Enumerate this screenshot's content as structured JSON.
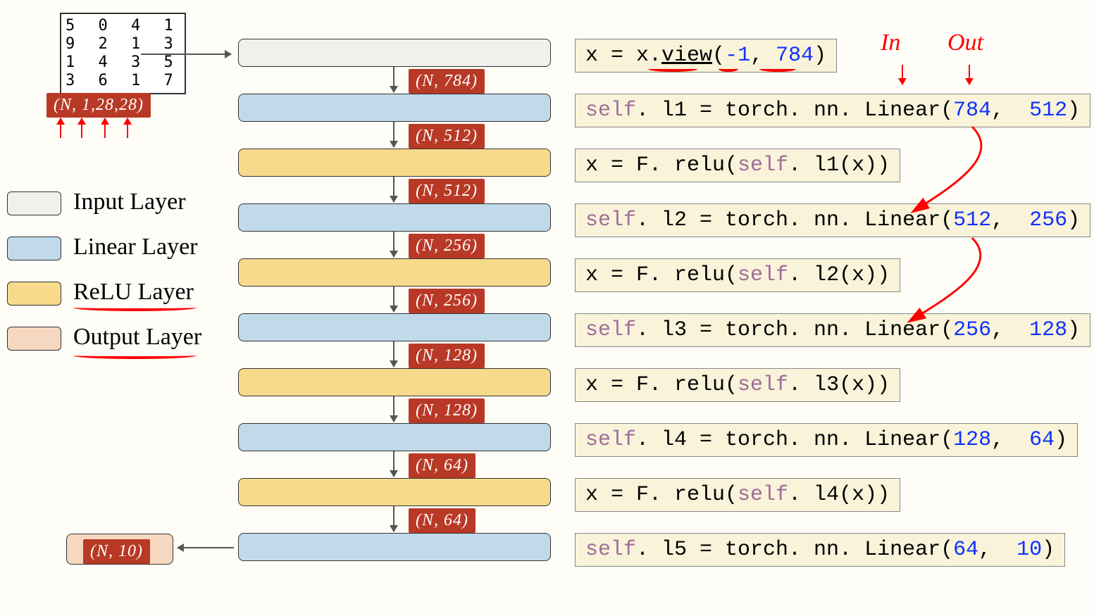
{
  "shapes": {
    "input_badge": "(N, 1,28,28)",
    "s1": "(N, 784)",
    "s2": "(N, 512)",
    "s3": "(N, 512)",
    "s4": "(N, 256)",
    "s5": "(N, 256)",
    "s6": "(N, 128)",
    "s7": "(N, 128)",
    "s8": "(N, 64)",
    "s9": "(N, 64)",
    "output_badge": "(N, 10)"
  },
  "code": {
    "c1_a": "x = x.",
    "c1_b": "view",
    "c1_c": "(",
    "c1_d": "-1",
    "c1_e": ", ",
    "c1_f": "784",
    "c1_g": ")",
    "c2_a": "self",
    "c2_b": ". l1 = torch. nn. Linear(",
    "c2_c": "784",
    "c2_d": ",  ",
    "c2_e": "512",
    "c2_f": ")",
    "c3_a": "x = F. relu(",
    "c3_b": "self",
    "c3_c": ". l1(x))",
    "c4_a": "self",
    "c4_b": ". l2 = torch. nn. Linear(",
    "c4_c": "512",
    "c4_d": ",  ",
    "c4_e": "256",
    "c4_f": ")",
    "c5_a": "x = F. relu(",
    "c5_b": "self",
    "c5_c": ". l2(x))",
    "c6_a": "self",
    "c6_b": ". l3 = torch. nn. Linear(",
    "c6_c": "256",
    "c6_d": ",  ",
    "c6_e": "128",
    "c6_f": ")",
    "c7_a": "x = F. relu(",
    "c7_b": "self",
    "c7_c": ". l3(x))",
    "c8_a": "self",
    "c8_b": ". l4 = torch. nn. Linear(",
    "c8_c": "128",
    "c8_d": ",  ",
    "c8_e": "64",
    "c8_f": ")",
    "c9_a": "x = F. relu(",
    "c9_b": "self",
    "c9_c": ". l4(x))",
    "c10_a": "self",
    "c10_b": ". l5 = torch. nn. Linear(",
    "c10_c": "64",
    "c10_d": ",  ",
    "c10_e": "10",
    "c10_f": ")"
  },
  "legend": {
    "input": "Input Layer",
    "linear": "Linear Layer",
    "relu": "ReLU Layer",
    "output": "Output Layer"
  },
  "hand": {
    "in": "In",
    "out": "Out"
  },
  "mnist_rows": [
    "5 0 4 1",
    "9 2 1 3",
    "1 4 3 5",
    "3 6 1 7"
  ]
}
